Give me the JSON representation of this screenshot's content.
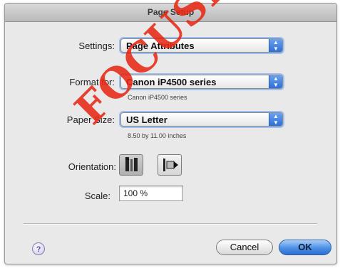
{
  "window": {
    "title": "Page Setup"
  },
  "settings": {
    "label": "Settings:",
    "value": "Page Attributes"
  },
  "format": {
    "label": "Format for:",
    "value": "Canon iP4500 series",
    "sub": "Canon iP4500 series"
  },
  "paper": {
    "label": "Paper Size:",
    "value": "US Letter",
    "sub": "8.50 by 11.00 inches"
  },
  "orientation": {
    "label": "Orientation:",
    "options": [
      {
        "name": "portrait",
        "selected": true,
        "icon": "portrait-orientation-icon"
      },
      {
        "name": "landscape",
        "selected": false,
        "icon": "landscape-orientation-icon"
      }
    ]
  },
  "scale": {
    "label": "Scale:",
    "value": "100 %"
  },
  "buttons": {
    "help": "?",
    "cancel": "Cancel",
    "ok": "OK"
  },
  "overlay": {
    "stamp_text": "FOCUSED",
    "color": "#e62814"
  },
  "colors": {
    "accent": "#3f7fe0",
    "focus_ring": "#9fc0ef"
  }
}
